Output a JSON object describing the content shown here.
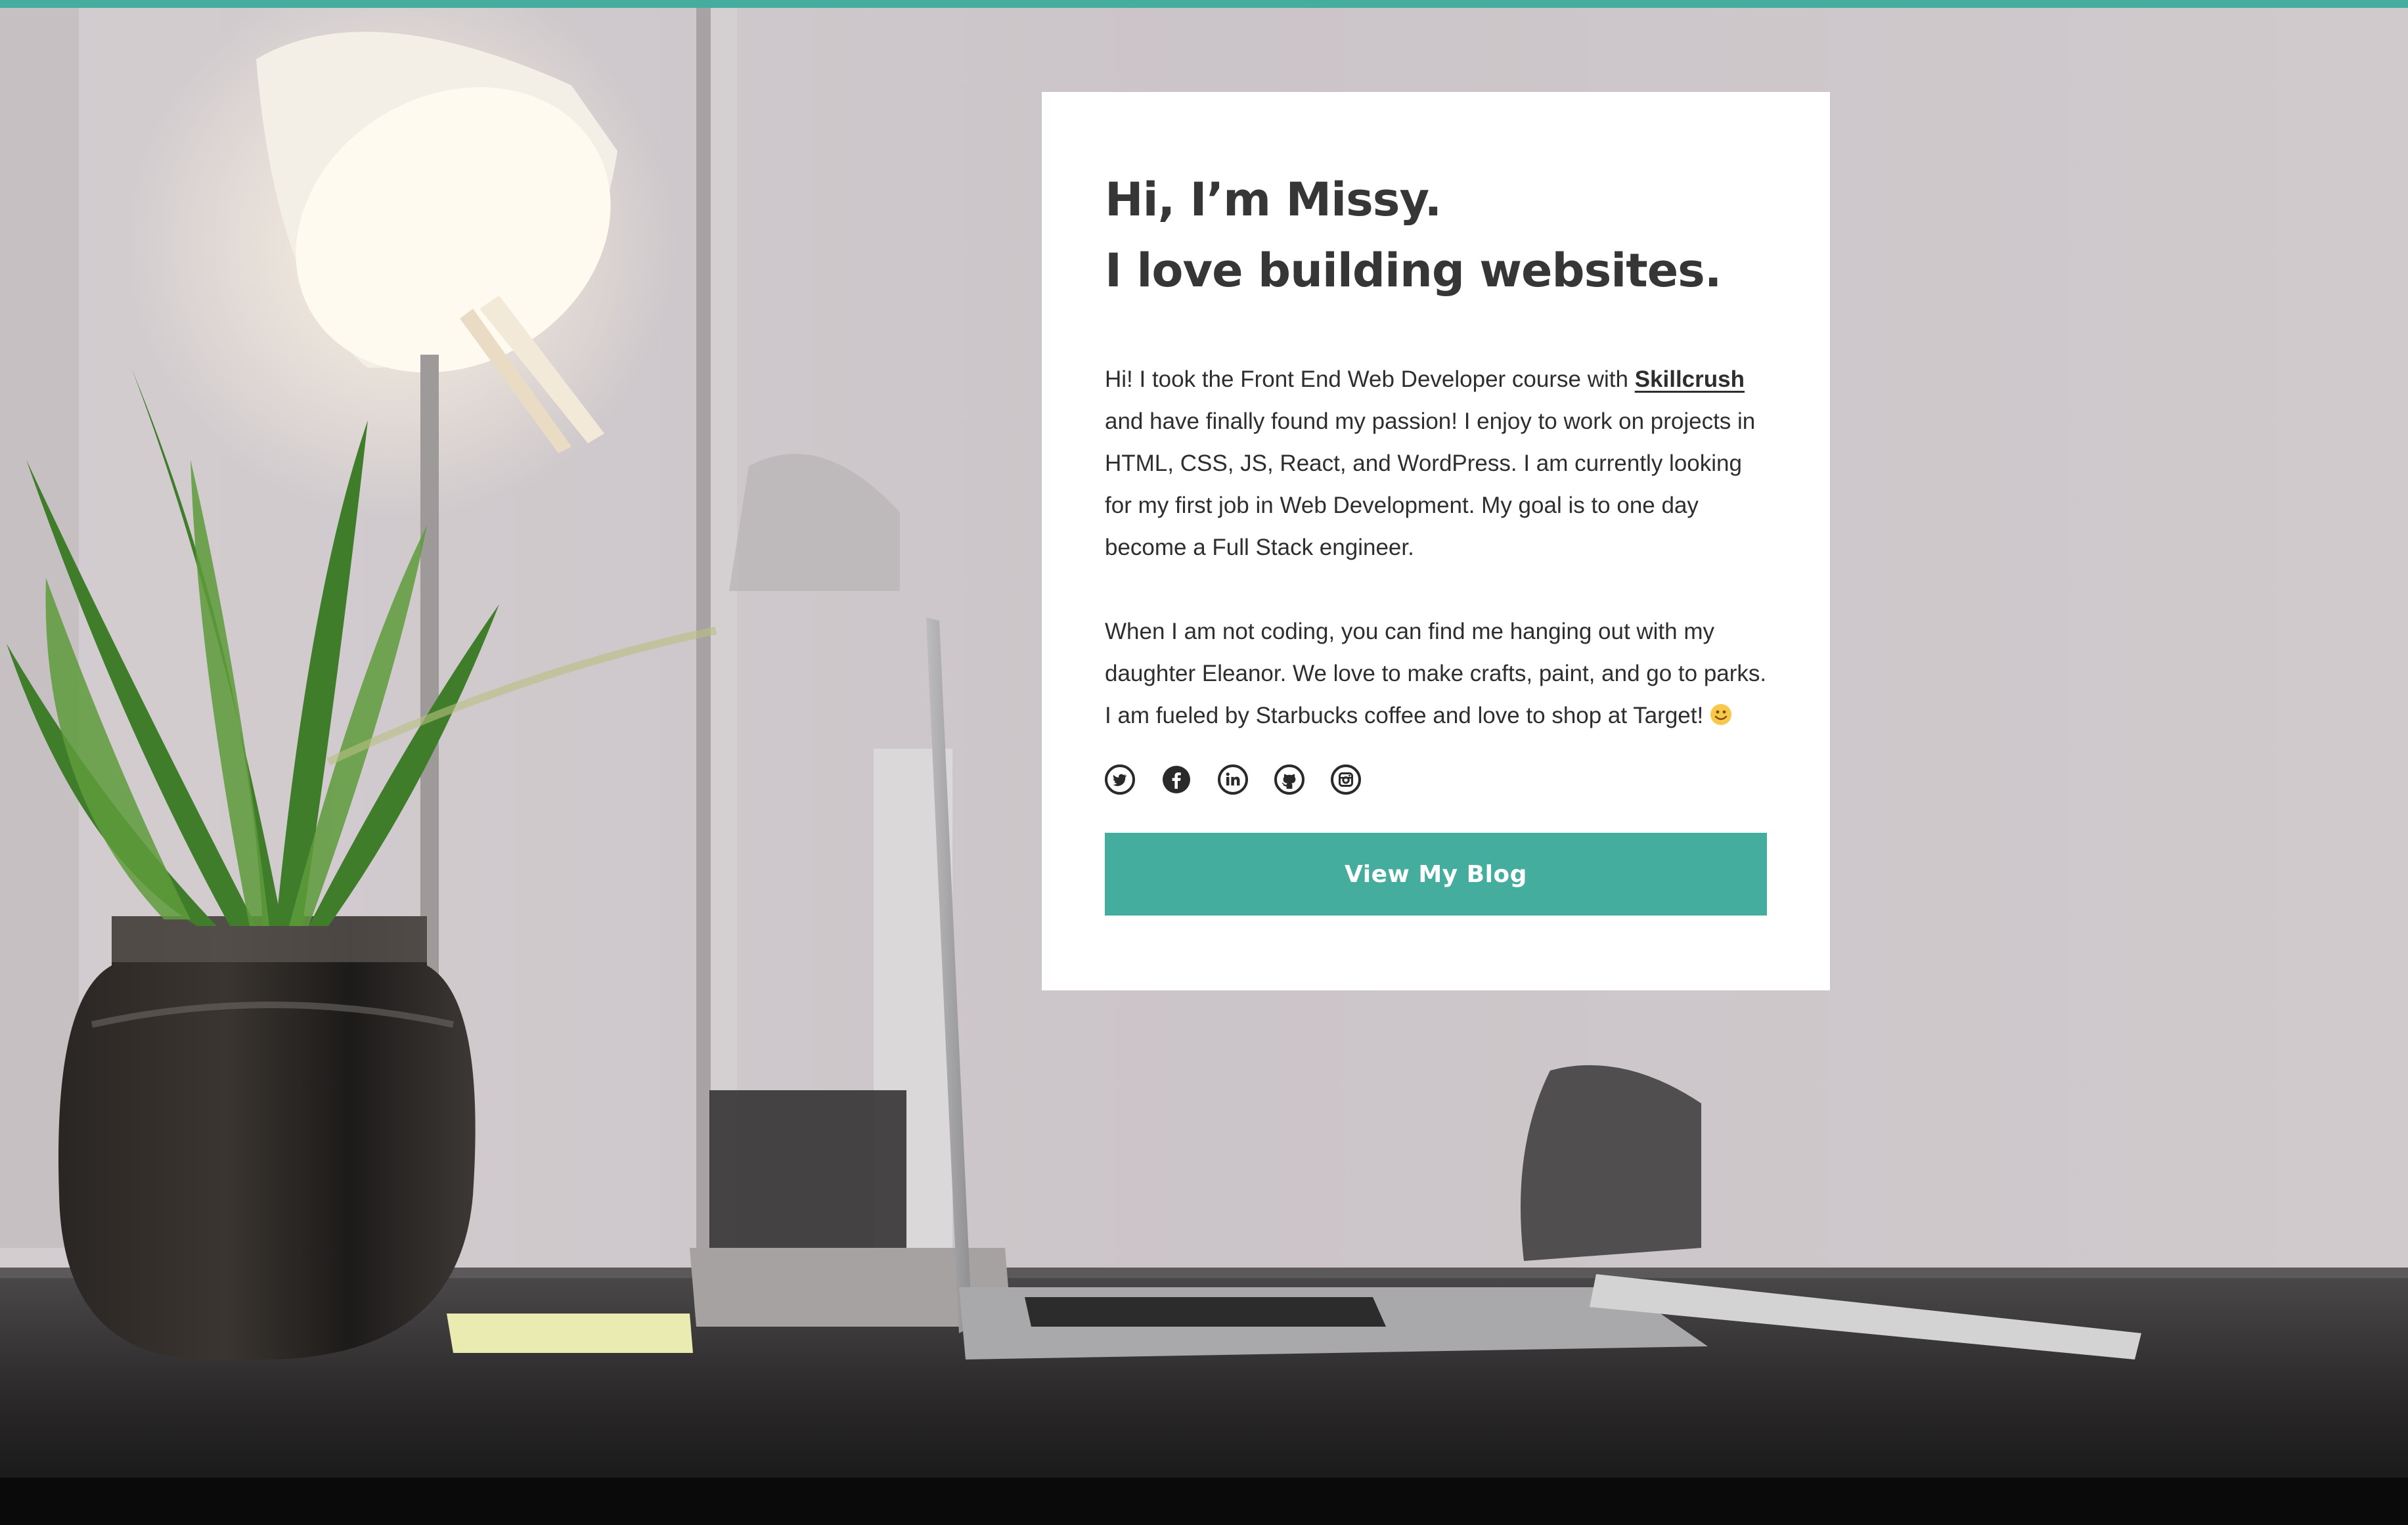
{
  "colors": {
    "accent": "#45ad9e",
    "card_bg": "#ffffff",
    "heading": "#363636",
    "body_text": "#2e2e2e",
    "wall": "#cdc6c9",
    "desk": "#1e1e20"
  },
  "hero": {
    "headline_line1": "Hi, I’m Missy.",
    "headline_line2": "I love building websites.",
    "bio_p1_before_link": "Hi! I took the Front End Web Developer course with ",
    "bio_p1_link": "Skillcrush",
    "bio_p1_after_link": " and have finally found my passion! I enjoy to work on projects in HTML, CSS, JS, React, and WordPress. I am currently looking for my first job in Web Development. My goal is to one day become a Full Stack engineer.",
    "bio_p2": "When I am not coding, you can find me hanging out with my daughter Eleanor. We love to make crafts, paint, and go to parks. I am fueled by Starbucks coffee and love to shop at Target! ",
    "smiley_icon": "smiley-face-icon",
    "cta_label": "View My Blog"
  },
  "social": {
    "items": [
      {
        "icon": "twitter-icon"
      },
      {
        "icon": "facebook-icon"
      },
      {
        "icon": "linkedin-icon"
      },
      {
        "icon": "github-icon"
      },
      {
        "icon": "instagram-icon"
      }
    ]
  }
}
